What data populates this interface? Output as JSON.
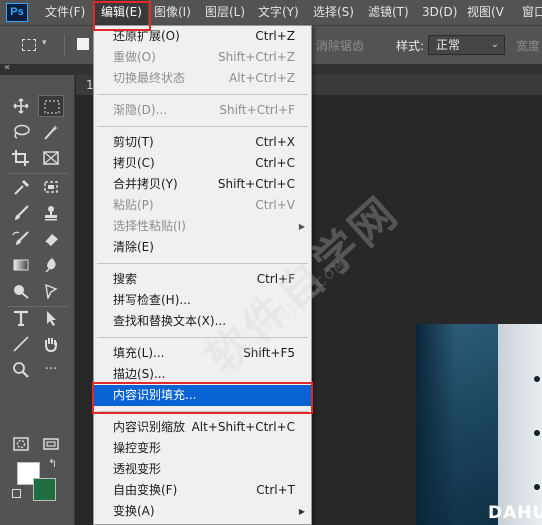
{
  "app": {
    "logo": "Ps"
  },
  "menubar": {
    "items": [
      {
        "label": "文件(F)"
      },
      {
        "label": "编辑(E)"
      },
      {
        "label": "图像(I)"
      },
      {
        "label": "图层(L)"
      },
      {
        "label": "文字(Y)"
      },
      {
        "label": "选择(S)"
      },
      {
        "label": "滤镜(T)"
      },
      {
        "label": "3D(D)"
      },
      {
        "label": "视图(V"
      },
      {
        "label": "窗口"
      }
    ]
  },
  "options_bar": {
    "feather_text": "消除锯齿",
    "style_label": "样式:",
    "style_value": "正常",
    "width_label": "宽度"
  },
  "tools_header": {
    "collapse": "«"
  },
  "document": {
    "tab_number": "1",
    "photo_text": "DAHU"
  },
  "watermark": {
    "text": "软件自学网",
    "url": "WWW.RJZXW.COM"
  },
  "edit_menu": {
    "items": [
      {
        "label": "还原扩展(O)",
        "shortcut": "Ctrl+Z",
        "enabled": true
      },
      {
        "label": "重做(O)",
        "shortcut": "Shift+Ctrl+Z",
        "enabled": false
      },
      {
        "label": "切换最终状态",
        "shortcut": "Alt+Ctrl+Z",
        "enabled": false
      },
      {
        "label": "渐隐(D)...",
        "shortcut": "Shift+Ctrl+F",
        "enabled": false
      },
      {
        "label": "剪切(T)",
        "shortcut": "Ctrl+X",
        "enabled": true
      },
      {
        "label": "拷贝(C)",
        "shortcut": "Ctrl+C",
        "enabled": true
      },
      {
        "label": "合并拷贝(Y)",
        "shortcut": "Shift+Ctrl+C",
        "enabled": true
      },
      {
        "label": "粘贴(P)",
        "shortcut": "Ctrl+V",
        "enabled": false
      },
      {
        "label": "选择性粘贴(I)",
        "shortcut": "",
        "enabled": false,
        "submenu": true
      },
      {
        "label": "清除(E)",
        "shortcut": "",
        "enabled": true
      },
      {
        "label": "搜索",
        "shortcut": "Ctrl+F",
        "enabled": true
      },
      {
        "label": "拼写检查(H)...",
        "shortcut": "",
        "enabled": true
      },
      {
        "label": "查找和替换文本(X)...",
        "shortcut": "",
        "enabled": true
      },
      {
        "label": "填充(L)...",
        "shortcut": "Shift+F5",
        "enabled": true
      },
      {
        "label": "描边(S)...",
        "shortcut": "",
        "enabled": true
      },
      {
        "label": "内容识别填充...",
        "shortcut": "",
        "enabled": true,
        "highlighted": true
      },
      {
        "label": "内容识别缩放",
        "shortcut": "Alt+Shift+Ctrl+C",
        "enabled": true
      },
      {
        "label": "操控变形",
        "shortcut": "",
        "enabled": true
      },
      {
        "label": "透视变形",
        "shortcut": "",
        "enabled": true
      },
      {
        "label": "自由变换(F)",
        "shortcut": "Ctrl+T",
        "enabled": true
      },
      {
        "label": "变换(A)",
        "shortcut": "",
        "enabled": true,
        "submenu": true
      }
    ]
  },
  "colors": {
    "foreground": "#ffffff",
    "background": "#1e6e42",
    "highlight": "#0a63d4",
    "annotation_red": "#e02a2a"
  }
}
